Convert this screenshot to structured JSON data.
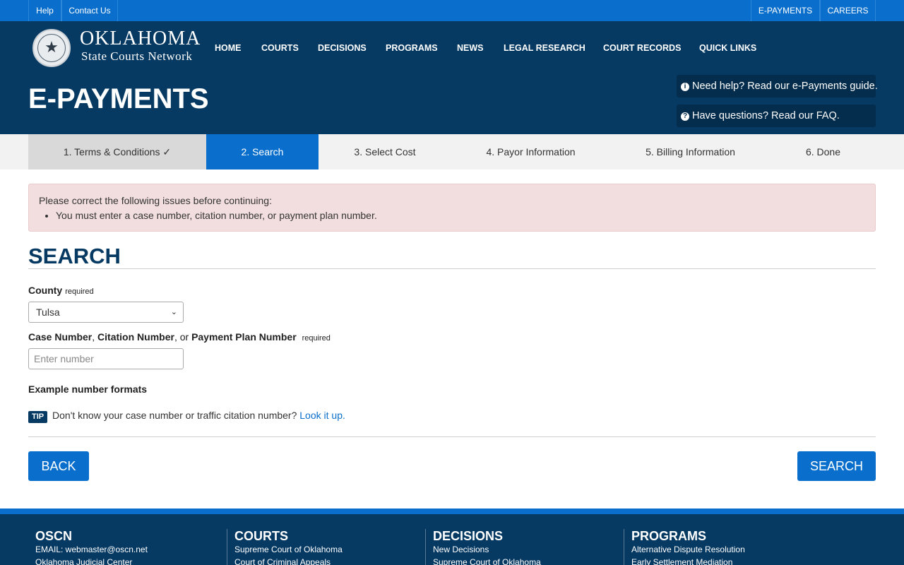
{
  "topbar": {
    "help": "Help",
    "contact": "Contact Us",
    "epayments": "E-PAYMENTS",
    "careers": "CAREERS"
  },
  "brand": {
    "line1": "OKLAHOMA",
    "line2": "State Courts Network"
  },
  "nav": [
    "HOME",
    "COURTS",
    "DECISIONS",
    "PROGRAMS",
    "NEWS",
    "LEGAL RESEARCH",
    "COURT RECORDS",
    "QUICK LINKS"
  ],
  "page_title": "E-PAYMENTS",
  "help_links": {
    "guide": "Need help? Read our e-Payments guide.",
    "faq": "Have questions? Read our FAQ."
  },
  "steps": [
    "1. Terms & Conditions ✓",
    "2. Search",
    "3. Select Cost",
    "4. Payor Information",
    "5. Billing Information",
    "6. Done"
  ],
  "alert": {
    "heading": "Please correct the following issues before continuing:",
    "items": [
      "You must enter a case number, citation number, or payment plan number."
    ]
  },
  "search": {
    "heading": "SEARCH",
    "county_label": "County",
    "required": "required",
    "county_value": "Tulsa",
    "case_label_1": "Case Number",
    "sep_1": ", ",
    "case_label_2": "Citation Number",
    "sep_2": ", or ",
    "case_label_3": "Payment Plan Number",
    "case_placeholder": "Enter number",
    "examples": "Example number formats",
    "tip_badge": "TIP",
    "tip_text": "Don't know your case number or traffic citation number?",
    "tip_link": "Look it up."
  },
  "buttons": {
    "back": "BACK",
    "search": "SEARCH"
  },
  "footer": {
    "cols": [
      {
        "title": "OSCN",
        "links": [
          "EMAIL: webmaster@oscn.net",
          "Oklahoma Judicial Center"
        ]
      },
      {
        "title": "COURTS",
        "links": [
          "Supreme Court of Oklahoma",
          "Court of Criminal Appeals"
        ]
      },
      {
        "title": "DECISIONS",
        "links": [
          "New Decisions",
          "Supreme Court of Oklahoma"
        ]
      },
      {
        "title": "PROGRAMS",
        "links": [
          "Alternative Dispute Resolution",
          "Early Settlement Mediation"
        ]
      }
    ]
  },
  "colors": {
    "primary": "#0a6fcc",
    "navy": "#063a63",
    "alert_bg": "#f2dede"
  }
}
